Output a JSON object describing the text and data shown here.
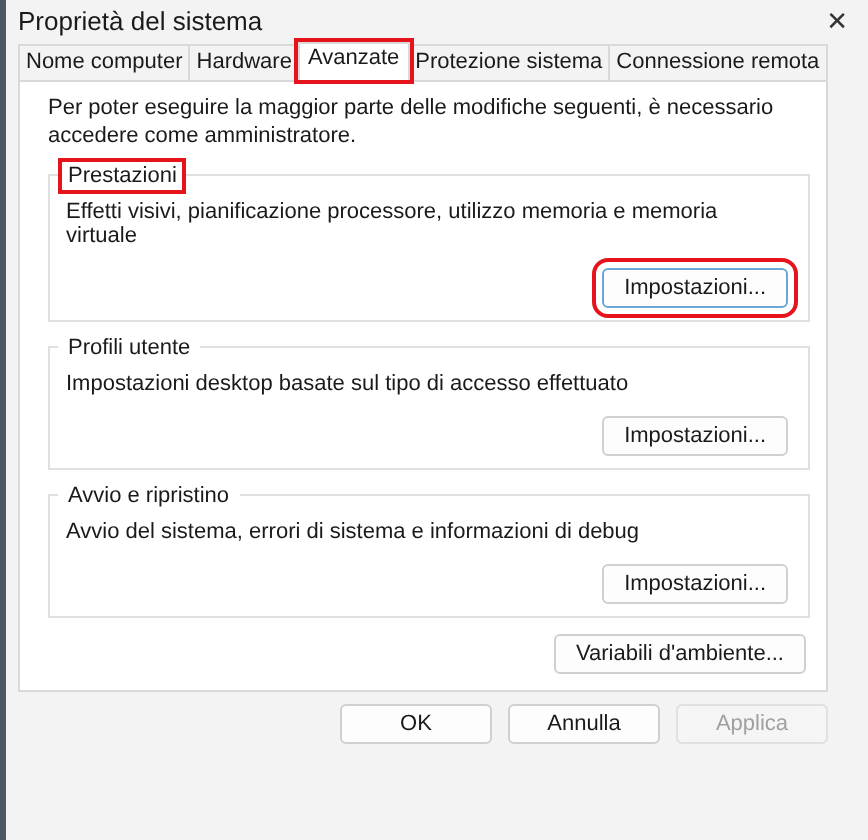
{
  "window": {
    "title": "Proprietà del sistema",
    "close": "✕"
  },
  "tabs": [
    {
      "label": "Nome computer",
      "selected": false,
      "highlighted": false
    },
    {
      "label": "Hardware",
      "selected": false,
      "highlighted": false
    },
    {
      "label": "Avanzate",
      "selected": true,
      "highlighted": true
    },
    {
      "label": "Protezione sistema",
      "selected": false,
      "highlighted": false
    },
    {
      "label": "Connessione remota",
      "selected": false,
      "highlighted": false
    }
  ],
  "notice": "Per poter eseguire la maggior parte delle modifiche seguenti, è necessario accedere come amministratore.",
  "groups": [
    {
      "title": "Prestazioni",
      "title_highlighted": true,
      "description": "Effetti visivi, pianificazione processore, utilizzo memoria e memoria virtuale",
      "button": {
        "label": "Impostazioni...",
        "highlighted": true
      }
    },
    {
      "title": "Profili utente",
      "title_highlighted": false,
      "description": "Impostazioni desktop basate sul tipo di accesso effettuato",
      "button": {
        "label": "Impostazioni...",
        "highlighted": false
      }
    },
    {
      "title": "Avvio e ripristino",
      "title_highlighted": false,
      "description": "Avvio del sistema, errori di sistema e informazioni di debug",
      "button": {
        "label": "Impostazioni...",
        "highlighted": false
      }
    }
  ],
  "env_button": "Variabili d'ambiente...",
  "buttons": [
    {
      "label": "OK",
      "disabled": false
    },
    {
      "label": "Annulla",
      "disabled": false
    },
    {
      "label": "Applica",
      "disabled": true
    }
  ]
}
